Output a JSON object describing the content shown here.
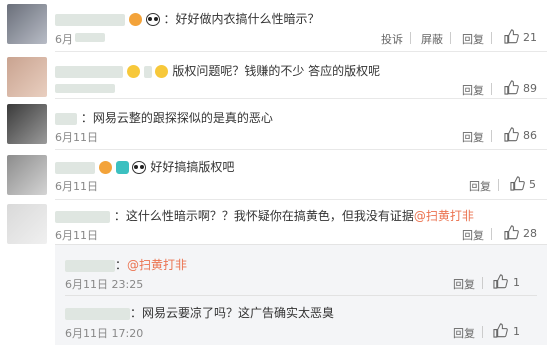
{
  "comments": [
    {
      "text": "：好好做内衣搞什么性暗示？",
      "date": "6月",
      "actions": [
        "投诉",
        "屏蔽",
        "回复"
      ],
      "likes": "21"
    },
    {
      "text": "版权问题呢？钱赚的不少 答应的版权呢",
      "date": "",
      "actions": [
        "回复"
      ],
      "likes": "89"
    },
    {
      "text": "：网易云整的跟探探似的是真的恶心",
      "date": "6月11日",
      "actions": [
        "回复"
      ],
      "likes": "86"
    },
    {
      "text": "好好搞搞版权吧",
      "date": "6月11日",
      "actions": [
        "回复"
      ],
      "likes": "5"
    },
    {
      "text": "：这什么性暗示啊？？我怀疑你在搞黄色，但我没有证据",
      "mention": "@扫黄打非",
      "date": "6月11日",
      "actions": [
        "回复"
      ],
      "likes": "28"
    }
  ],
  "replies": [
    {
      "text": "：",
      "mention": "@扫黄打非",
      "date": "6月11日 23:25",
      "actions": [
        "回复"
      ],
      "likes": "1"
    },
    {
      "text": "：网易云要凉了吗？这广告确实太恶臭",
      "date": "6月11日 17:20",
      "actions": [
        "回复"
      ],
      "likes": "1"
    }
  ],
  "colors": {
    "link": "#eb7350",
    "meta": "#888888",
    "reply_bg": "#f4f5f7"
  }
}
